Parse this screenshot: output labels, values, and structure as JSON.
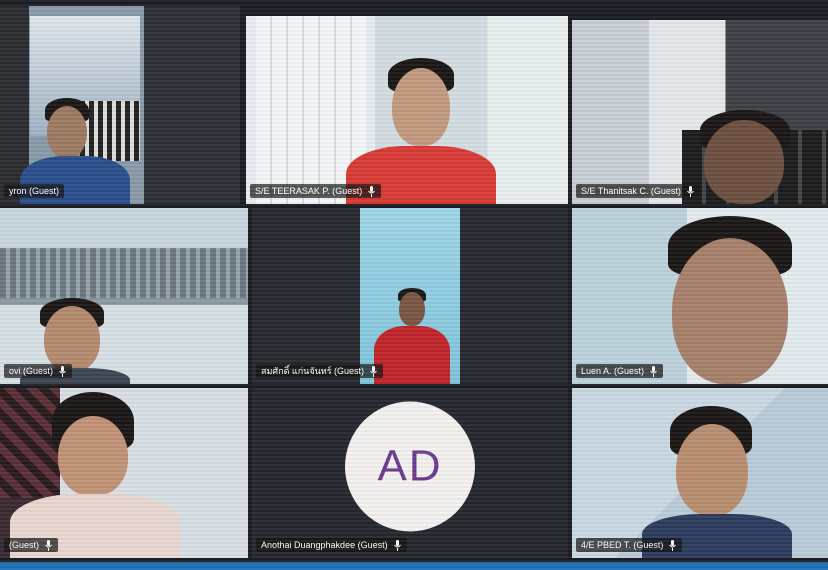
{
  "app": {
    "name": "Video conference gallery view"
  },
  "participants": [
    {
      "label": "yron (Guest)"
    },
    {
      "label": "S/E TEERASAK P. (Guest)"
    },
    {
      "label": "S/E Thanitsak C. (Guest)"
    },
    {
      "label": "ovi (Guest)"
    },
    {
      "label": "สมศักดิ์ แก่นจันทร์ (Guest)"
    },
    {
      "label": "Luen A. (Guest)"
    },
    {
      "label": "(Guest)"
    },
    {
      "label": "Anothai Duangphakdee (Guest)",
      "initials": "AD"
    },
    {
      "label": "4/E PBED T. (Guest)"
    }
  ],
  "colors": {
    "background": "#1b1d22",
    "namebar": "#141414",
    "avatar_bg": "#f3f0f0",
    "avatar_text": "#6a3b8f",
    "taskbar": "#1f6fb5"
  },
  "icons": {
    "mic_status": "mic-icon"
  }
}
